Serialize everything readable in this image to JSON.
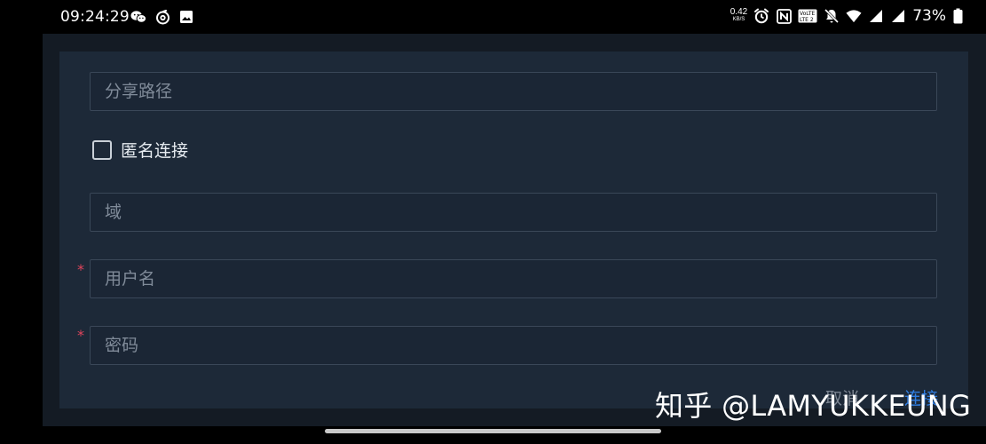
{
  "status_bar": {
    "time": "09:24:29",
    "left_icons": [
      "wechat-icon",
      "netease-music-icon",
      "gallery-icon"
    ],
    "net_speed_value": "0.42",
    "net_speed_unit": "KB/S",
    "volte_label": "VoLTE2",
    "right_icons": [
      "alarm-icon",
      "nfc-icon",
      "volte-icon",
      "mute-icon",
      "wifi-icon",
      "cellular-signal-icon",
      "cellular-signal-2-icon",
      "battery-icon"
    ],
    "battery_percent": "73%"
  },
  "form": {
    "share_path": {
      "placeholder": "分享路径",
      "value": ""
    },
    "anonymous_checkbox": {
      "label": "匿名连接",
      "checked": false
    },
    "domain": {
      "placeholder": "域",
      "value": ""
    },
    "username": {
      "placeholder": "用户名",
      "value": "",
      "required_mark": "*"
    },
    "password": {
      "placeholder": "密码",
      "value": "",
      "required_mark": "*"
    }
  },
  "footer": {
    "cancel_label": "取消",
    "connect_label": "连接"
  },
  "watermark": "知乎 @LAMYUKKEUNG",
  "colors": {
    "dialog_bg": "#1d2938",
    "accent": "#2f7de1",
    "required": "#e0445c"
  }
}
